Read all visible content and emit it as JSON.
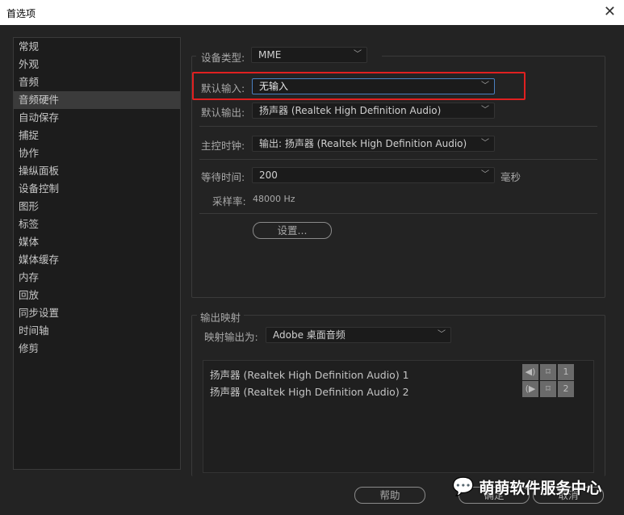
{
  "window": {
    "title": "首选项",
    "close": "✕"
  },
  "sidebar": {
    "items": [
      "常规",
      "外观",
      "音频",
      "音频硬件",
      "自动保存",
      "捕捉",
      "协作",
      "操纵面板",
      "设备控制",
      "图形",
      "标签",
      "媒体",
      "媒体缓存",
      "内存",
      "回放",
      "同步设置",
      "时间轴",
      "修剪"
    ],
    "selected": 3
  },
  "hardware": {
    "device_type_label": "设备类型:",
    "device_type": "MME",
    "default_input_label": "默认输入:",
    "default_input": "无输入",
    "default_output_label": "默认输出:",
    "default_output": "扬声器 (Realtek High Definition Audio)",
    "master_clock_label": "主控时钟:",
    "master_clock": "输出: 扬声器 (Realtek High Definition Audio)",
    "latency_label": "等待时间:",
    "latency": "200",
    "latency_unit": "毫秒",
    "sample_rate_label": "采样率:",
    "sample_rate": "48000 Hz",
    "settings_button": "设置..."
  },
  "mapping": {
    "title": "输出映射",
    "map_to_label": "映射输出为:",
    "map_to": "Adobe 桌面音频",
    "channels": [
      {
        "name": "扬声器 (Realtek High Definition Audio) 1",
        "num": "1"
      },
      {
        "name": "扬声器 (Realtek High Definition Audio) 2",
        "num": "2"
      }
    ]
  },
  "footer": {
    "help": "帮助",
    "ok": "确定",
    "cancel": "取消"
  },
  "watermark": "萌萌软件服务中心",
  "colors": {
    "highlight": "#e02020",
    "focus": "#4a7fc0"
  }
}
